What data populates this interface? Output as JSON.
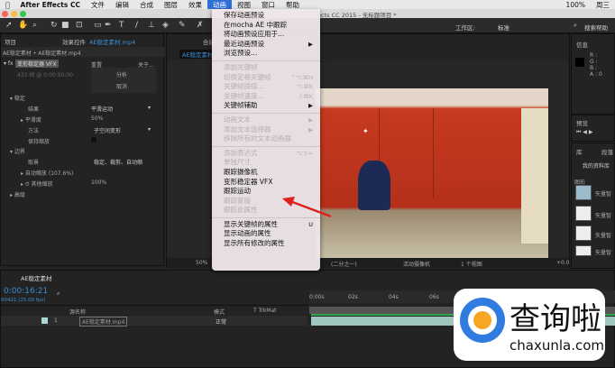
{
  "menubar": {
    "apple": "",
    "app": "After Effects CC",
    "items": [
      "文件",
      "编辑",
      "合成",
      "图层",
      "效果",
      "动画",
      "视图",
      "窗口",
      "帮助"
    ],
    "battery": "100%",
    "day": "周三"
  },
  "window": {
    "title": "ects CC 2015 - 无标题项目 *"
  },
  "workspace": {
    "label": "工作区:",
    "value": "标准",
    "search": "搜索帮助"
  },
  "project_tab": "项目",
  "effects_panel": {
    "tab_prefix": "效果控件",
    "tab_file": "AE稳定素材.mp4",
    "breadcrumb": "AE稳定素材 • AE稳定素材.mp4",
    "effect_name": "变形稳定器 VFX",
    "reset": "重置",
    "about": "关于...",
    "status": "433 帧 @ 0:00:00:00",
    "analyze": "分析",
    "cancel": "取消",
    "rows": [
      {
        "label": "稳定",
        "value": ""
      },
      {
        "label": "结果",
        "value": "平滑运动"
      },
      {
        "label": "平滑度",
        "value": "50%"
      },
      {
        "label": "方法",
        "value": "子空间变形"
      },
      {
        "label": "保持缩放",
        "value": ""
      },
      {
        "label": "边界",
        "value": ""
      },
      {
        "label": "取景",
        "value": "稳定、裁剪、自动缩"
      },
      {
        "label": "自动缩放 (107.6%)",
        "value": ""
      },
      {
        "label": "其他缩放",
        "value": "100%"
      },
      {
        "label": "高级",
        "value": ""
      }
    ]
  },
  "comp_panel": {
    "tab": "合成",
    "comp_tab": "AE稳定素材",
    "zoom": "50%",
    "resolution": "(二分之一)",
    "camera": "活动摄像机",
    "views": "1 个视图",
    "offset": "+0.0"
  },
  "info_panel": {
    "tab": "信息",
    "r": "R :",
    "g": "G :",
    "b": "B :",
    "a": "A : 0"
  },
  "preview_panel": {
    "tab": "预览"
  },
  "library_panel": {
    "tab": "库",
    "tab2": "段落",
    "library": "我的资料库",
    "section": "图形",
    "items": [
      "矢量智",
      "矢量智",
      "矢量智",
      "矢量智"
    ]
  },
  "menu": {
    "groups": [
      [
        {
          "label": "保存动画预设",
          "enabled": true
        },
        {
          "label": "在mocha AE 中跟踪",
          "enabled": true
        },
        {
          "label": "将动画预设应用于...",
          "enabled": true
        },
        {
          "label": "最近动画预设",
          "enabled": true,
          "sub": "▶"
        },
        {
          "label": "浏览预设...",
          "enabled": true
        }
      ],
      [
        {
          "label": "添加关键帧",
          "enabled": false
        },
        {
          "label": "切换定格关键帧",
          "enabled": false,
          "sc": "^⌥⌘H"
        },
        {
          "label": "关键帧插值...",
          "enabled": false,
          "sc": "⌥⌘K"
        },
        {
          "label": "关键帧速度...",
          "enabled": false,
          "sc": "⇧⌘K"
        },
        {
          "label": "关键帧辅助",
          "enabled": true,
          "sub": "▶"
        }
      ],
      [
        {
          "label": "动画文本",
          "enabled": false,
          "sub": "▶"
        },
        {
          "label": "添加文本选择器",
          "enabled": false,
          "sub": "▶"
        },
        {
          "label": "移除所有的文本动画器",
          "enabled": false
        }
      ],
      [
        {
          "label": "添加表达式",
          "enabled": false,
          "sc": "⌥⇧="
        },
        {
          "label": "单独尺寸",
          "enabled": false
        },
        {
          "label": "跟踪摄像机",
          "enabled": true
        },
        {
          "label": "变形稳定器 VFX",
          "enabled": true
        },
        {
          "label": "跟踪运动",
          "enabled": true
        },
        {
          "label": "跟踪蒙版",
          "enabled": false
        },
        {
          "label": "跟踪此属性",
          "enabled": false
        }
      ],
      [
        {
          "label": "显示关键帧的属性",
          "enabled": true,
          "sc": "U"
        },
        {
          "label": "显示动画的属性",
          "enabled": true
        },
        {
          "label": "显示所有修改的属性",
          "enabled": true
        }
      ]
    ]
  },
  "timeline": {
    "tab": "AE稳定素材",
    "timecode": "0:00:16:21",
    "frames": "00421 (25.00 fps)",
    "col_source": "源名称",
    "col_mode": "模式",
    "col_trkmat": "T  TrkMat",
    "layer_num": "1",
    "layer_name": "AE稳定素材.mp4",
    "layer_mode": "正常",
    "ticks": [
      "0:00s",
      "02s",
      "04s",
      "06s"
    ]
  },
  "watermark": {
    "text": "查询啦",
    "url": "chaxunla.com"
  }
}
